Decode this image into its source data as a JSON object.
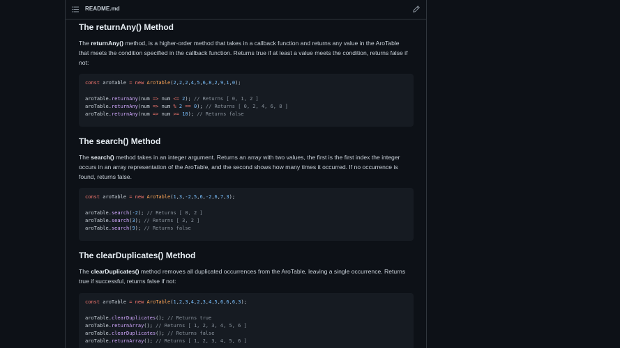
{
  "file_header": {
    "file_name": "README.md"
  },
  "icons": {
    "toc": "list-unordered-icon",
    "edit": "pencil-icon"
  },
  "sections": [
    {
      "heading": "The returnAny() Method",
      "intro_pre": "The ",
      "intro_bold": "returnAny()",
      "intro_post": " method, is a higher-order method that takes in a callback function and returns any value in the AroTable that meets the condition specified in the callback function. Returns true if at least a value meets the condition, returns false if not:",
      "code": [
        "const aroTable = new AroTable(2,2,2,4,5,6,8,2,9,1,0);",
        "",
        "aroTable.returnAny(num => num <= 2); // Returns [ 0, 1, 2 ]",
        "aroTable.returnAny(num => num % 2 == 0); // Returns [ 0, 2, 4, 6, 8 ]",
        "aroTable.returnAny(num => num >= 10); // Returns false"
      ]
    },
    {
      "heading": "The search() Method",
      "intro_pre": "The ",
      "intro_bold": "search()",
      "intro_post": " method takes in an integer argument. Returns an array with two values, the first is the first index the integer occurs in an array representation of the AroTable, and the second shows how many times it occurred. If no occurrence is found, returns false.",
      "code": [
        "const aroTable = new AroTable(1,3,-2,5,6,-2,6,7,3);",
        "",
        "aroTable.search(-2); // Returns [ 0, 2 ]",
        "aroTable.search(3); // Returns [ 3, 2 ]",
        "aroTable.search(9); // Returns false"
      ]
    },
    {
      "heading": "The clearDuplicates() Method",
      "intro_pre": "The ",
      "intro_bold": "clearDuplicates()",
      "intro_post": " method removes all duplicated occurrences from the AroTable, leaving a single occurrence. Returns true if successful, returns false if not:",
      "code": [
        "const aroTable = new AroTable(1,2,3,4,2,3,4,5,6,6,6,3);",
        "",
        "aroTable.clearDuplicates(); // Returns true",
        "aroTable.returnArray(); // Returns [ 1, 2, 3, 4, 5, 6 ]",
        "aroTable.clearDuplicates(); // Returns false",
        "aroTable.returnArray(); // Returns [ 1, 2, 3, 4, 5, 6 ]"
      ]
    }
  ]
}
